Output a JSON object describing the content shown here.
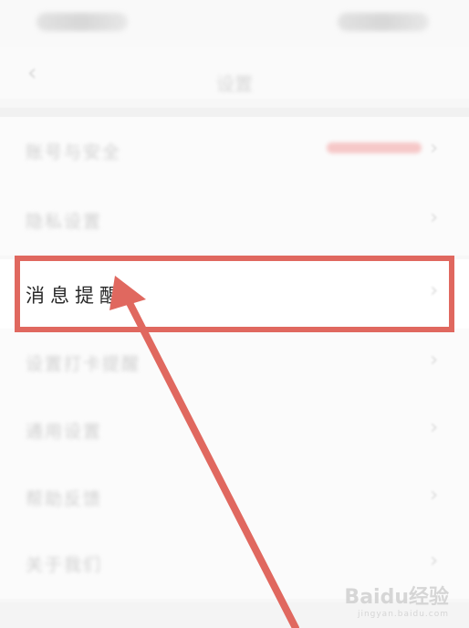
{
  "nav": {
    "title": "设置"
  },
  "rows": [
    {
      "label": "账号与安全",
      "value": true
    },
    {
      "label": "隐私设置"
    },
    {
      "label": "消息提醒",
      "active": true
    },
    {
      "label": "设置打卡提醒"
    },
    {
      "label": "通用设置"
    },
    {
      "label": "帮助反馈"
    },
    {
      "label": "关于我们"
    }
  ],
  "annotation": {
    "color": "#e0685f"
  },
  "watermark": {
    "brand": "Baidu经验",
    "url": "jingyan.baidu.com"
  }
}
